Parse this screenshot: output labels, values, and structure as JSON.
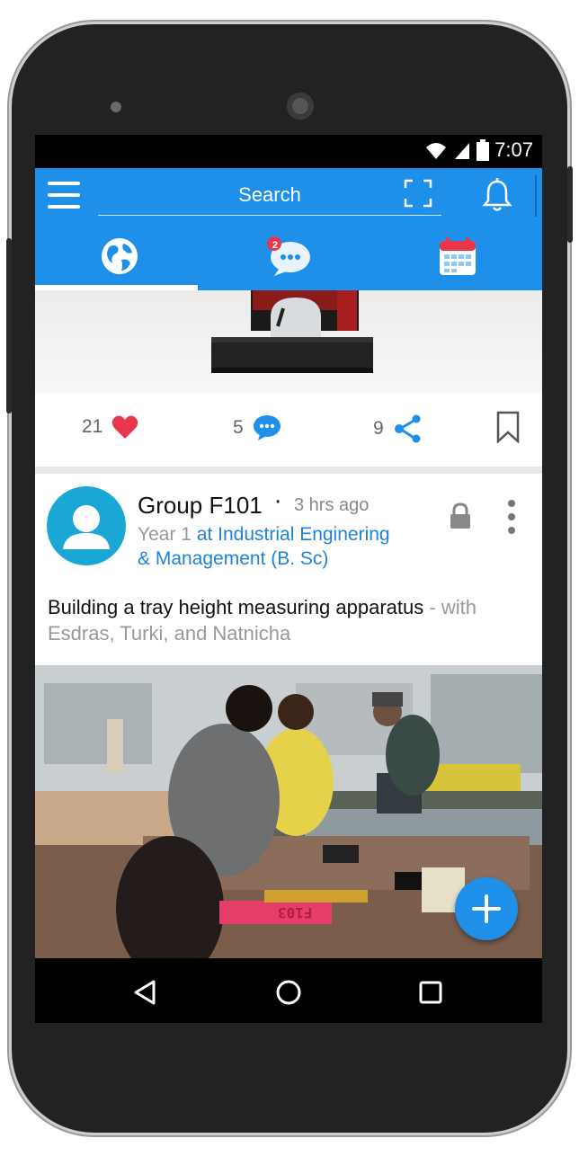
{
  "status": {
    "time": "7:07"
  },
  "topbar": {
    "search_label": "Search",
    "notification_badge": "2"
  },
  "tabs": [
    {
      "name": "world",
      "icon": "globe-icon"
    },
    {
      "name": "messages",
      "icon": "chat-icon"
    },
    {
      "name": "calendar",
      "icon": "calendar-icon"
    }
  ],
  "actions": {
    "likes": "21",
    "comments": "5",
    "shares": "9"
  },
  "post": {
    "group": "Group F101",
    "separator": "·",
    "time_ago": "3 hrs ago",
    "year": "Year 1",
    "org_line1": "at Industrial Enginering",
    "org_line2": "& Management (B. Sc)",
    "text": "Building a tray height measuring apparatus",
    "with_text": "- with Esdras, Turki, and Natnicha"
  },
  "photo": {
    "sign_text": "F103"
  },
  "colors": {
    "accent": "#1e90ea",
    "heart": "#e8374a",
    "link": "#1e82d8"
  }
}
